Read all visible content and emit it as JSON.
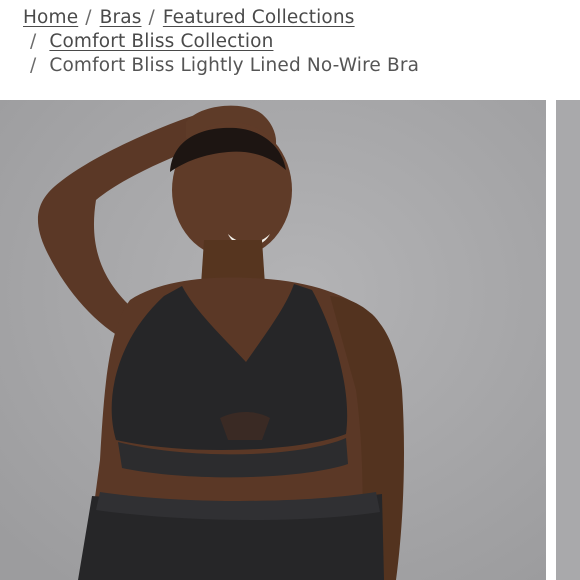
{
  "breadcrumb": {
    "separator": "/",
    "links": [
      "Home",
      "Bras",
      "Featured Collections",
      "Comfort Bliss Collection"
    ],
    "current": "Comfort Bliss Lightly Lined No-Wire Bra"
  },
  "gallery": {
    "background_color": "#a4a4a6",
    "product_color": "#262628"
  }
}
